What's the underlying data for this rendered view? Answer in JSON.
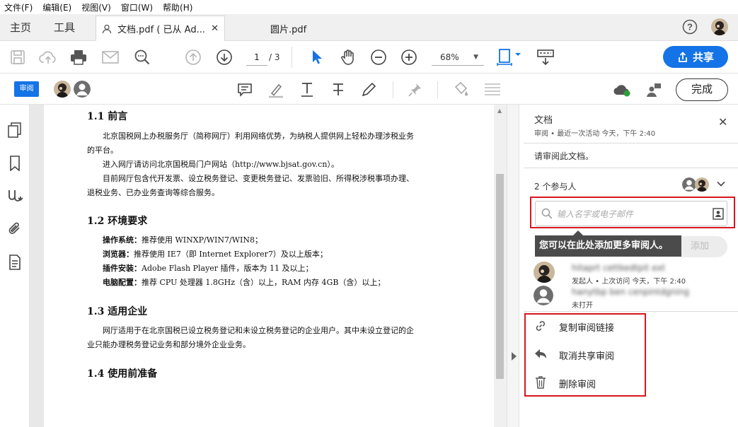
{
  "menu": [
    "文件(F)",
    "编辑(E)",
    "视图(V)",
    "窗口(W)",
    "帮助(H)"
  ],
  "tabs": {
    "home": "主页",
    "tools": "工具",
    "doc1": "文档.pdf ( 已从 Ad...",
    "doc2": "圆片.pdf"
  },
  "toolbar": {
    "page_current": "1",
    "page_total": "/ 3",
    "zoom": "68%",
    "share_label": "共享"
  },
  "reviewbar": {
    "tag": "审阅",
    "done_label": "完成"
  },
  "document": {
    "h1": "1.1  前言",
    "p1": "北京国税网上办税服务厅（简称网厅）利用网络优势，为纳税人提供网上轻松办理涉税业务的平台。",
    "p2": "进入网厅请访问北京国税局门户网站（http://www.bjsat.gov.cn）。",
    "p3": "目前网厅包含代开发票、设立税务登记、变更税务登记、发票验旧、所得税涉税事项办理、退税业务、已办业务查询等综合服务。",
    "h2": "1.2  环境要求",
    "env": [
      {
        "k": "操作系统：",
        "v": "推荐使用 WINXP/WIN7/WIN8；"
      },
      {
        "k": "浏览器：",
        "v": "推荐使用 IE7（即 Internet Explorer7）及以上版本；"
      },
      {
        "k": "插件安装：",
        "v": "Adobe Flash Player 插件，版本为 11 及以上；"
      },
      {
        "k": "电脑配置：",
        "v": "推荐 CPU 处理器 1.8GHz（含）以上，RAM 内存 4GB（含）以上；"
      }
    ],
    "h3": "1.3  适用企业",
    "p4": "网厅适用于在北京国税已设立税务登记和未设立税务登记的企业用户。其中未设立登记的企业只能办理税务登记业务和部分境外企业业务。",
    "h4": "1.4  使用前准备"
  },
  "panel": {
    "title": "文档",
    "subtitle": "审阅  •  最近一次活动 今天，下午 2:40",
    "message": "请审阅此文档。",
    "participants": "2 个参与人",
    "search_placeholder": "输入名字或电子邮件",
    "tooltip": "您可以在此处添加更多审阅人。",
    "add_label": "添加",
    "p1_name": "hitaprt cettkedtpit ext",
    "p1_status": "发起人 • 上次访问 今天，下午 2:40",
    "p2_name": "hanytbp ben cenpintdgning",
    "p2_status": "未打开",
    "actions": {
      "copy_link": "复制审阅链接",
      "unshare": "取消共享审阅",
      "delete": "删除审阅"
    }
  },
  "colors": {
    "accent": "#1473e6",
    "highlight_box": "#d7171f",
    "tooltip_bg": "#4b4b4b"
  }
}
